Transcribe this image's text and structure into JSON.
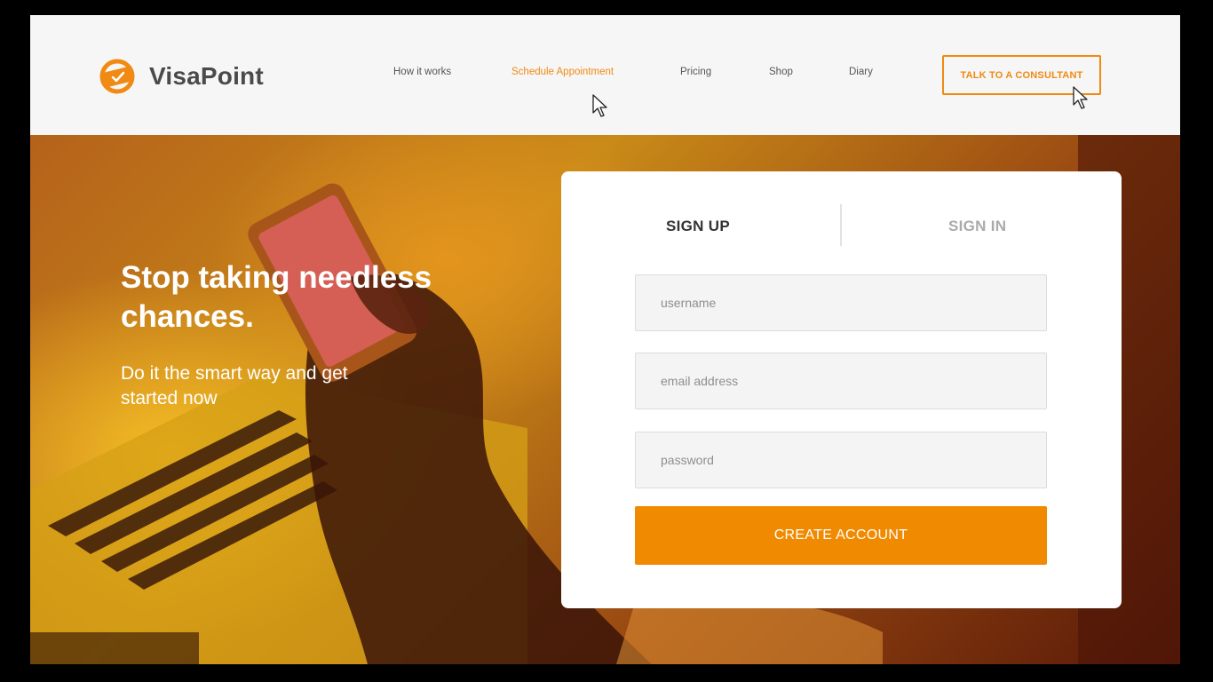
{
  "colors": {
    "accent": "#f08a12",
    "button": "#f08a00",
    "header_bg": "#f6f6f6",
    "text_dark": "#4a4a4a"
  },
  "header": {
    "logo_text": "VisaPoint",
    "nav": [
      {
        "label": "How it works",
        "active": false
      },
      {
        "label": "Schedule Appointment",
        "active": true
      },
      {
        "label": "Pricing",
        "active": false
      },
      {
        "label": "Shop",
        "active": false
      },
      {
        "label": "Diary",
        "active": false
      }
    ],
    "cta_label": "TALK TO A CONSULTANT"
  },
  "hero": {
    "headline": "Stop taking needless chances.",
    "subhead": "Do it the smart way and get started now"
  },
  "form": {
    "tabs": [
      {
        "label": "SIGN UP",
        "active": true
      },
      {
        "label": "SIGN IN",
        "active": false
      }
    ],
    "username_placeholder": "username",
    "email_placeholder": "email address",
    "password_placeholder": "password",
    "submit_label": "CREATE ACCOUNT"
  },
  "icons": {
    "logo": "orange-check-badge-icon",
    "pointer": "mouse-pointer-icon"
  }
}
